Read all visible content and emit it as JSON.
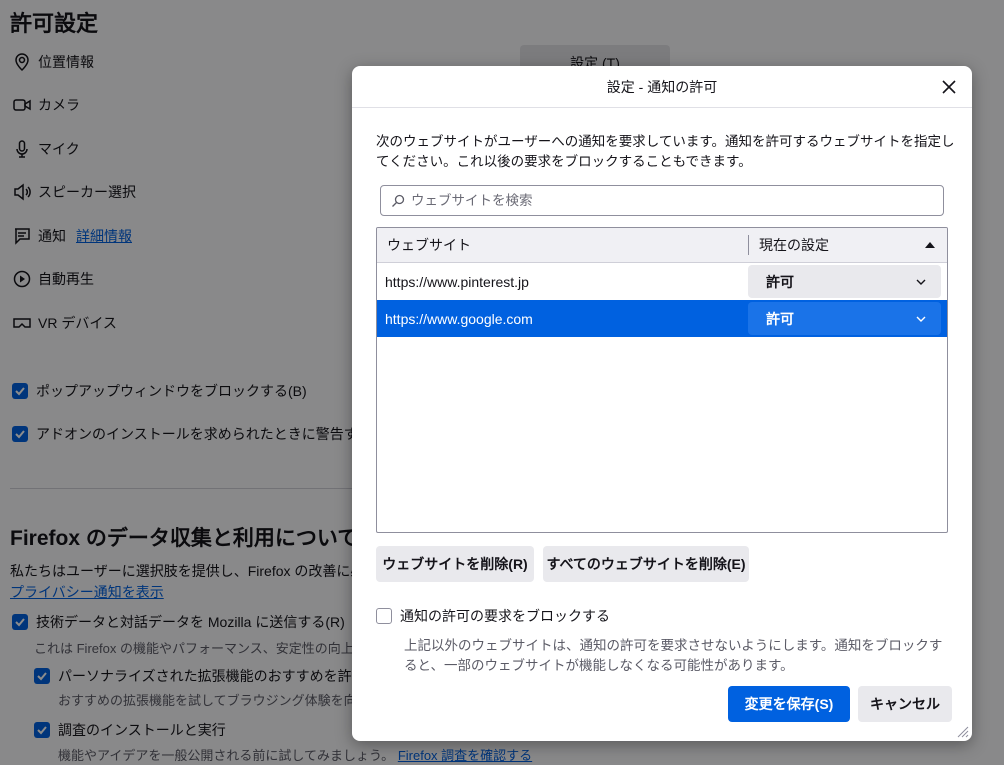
{
  "background": {
    "title": "許可設定",
    "settings_button": "設定 (T)",
    "permissions": [
      {
        "label": "位置情報",
        "icon": "location-icon"
      },
      {
        "label": "カメラ",
        "icon": "camera-icon"
      },
      {
        "label": "マイク",
        "icon": "microphone-icon"
      },
      {
        "label": "スピーカー選択",
        "icon": "speaker-icon"
      },
      {
        "label": "通知",
        "icon": "notification-icon",
        "link": "詳細情報"
      },
      {
        "label": "自動再生",
        "icon": "autoplay-icon"
      },
      {
        "label": "VR デバイス",
        "icon": "vr-icon"
      }
    ],
    "checkbox_popup": "ポップアップウィンドウをブロックする(B)",
    "checkbox_addon": "アドオンのインストールを求められたときに警告する(W)",
    "data_heading": "Firefox のデータ収集と利用について",
    "data_intro": "私たちはユーザーに選択肢を提供し、Firefox の改善に必要",
    "privacy_link": "プライバシー通知を表示",
    "check_tech": "技術データと対話データを Mozilla に送信する(R)",
    "check_tech_sub": "これは Firefox の機能やパフォーマンス、安定性の向上に役立",
    "check_personal": "パーソナライズされた拡張機能のおすすめを許可する",
    "check_personal_sub": "おすすめの拡張機能を試してブラウジング体験を向上させ",
    "check_studies": "調査のインストールと実行",
    "check_studies_sub": "機能やアイデアを一般公開される前に試してみましょう。",
    "studies_link": "Firefox 調査を確認する"
  },
  "dialog": {
    "title": "設定 - 通知の許可",
    "description": "次のウェブサイトがユーザーへの通知を要求しています。通知を許可するウェブサイトを指定してください。これ以後の要求をブロックすることもできます。",
    "search_placeholder": "ウェブサイトを検索",
    "col_website": "ウェブサイト",
    "col_status": "現在の設定",
    "rows": [
      {
        "site": "https://www.pinterest.jp",
        "status": "許可",
        "selected": false
      },
      {
        "site": "https://www.google.com",
        "status": "許可",
        "selected": true
      }
    ],
    "remove_button": "ウェブサイトを削除(R)",
    "remove_all_button": "すべてのウェブサイトを削除(E)",
    "block_checkbox": "通知の許可の要求をブロックする",
    "block_description": "上記以外のウェブサイトは、通知の許可を要求させないようにします。通知をブロックすると、一部のウェブサイトが機能しなくなる可能性があります。",
    "save_button": "変更を保存(S)",
    "cancel_button": "キャンセル"
  },
  "colors": {
    "accent": "#0061e0",
    "selected_row": "#0061e0"
  }
}
